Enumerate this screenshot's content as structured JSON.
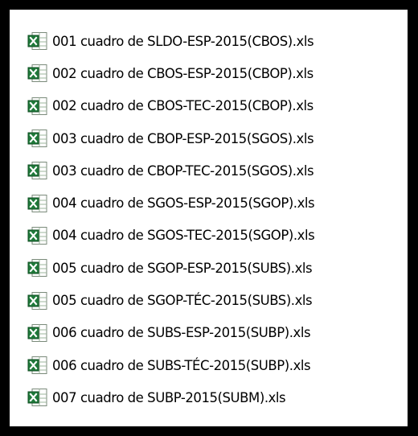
{
  "files": [
    {
      "name": "001 cuadro de SLDO-ESP-2015(CBOS).xls",
      "icon": "excel-file-icon"
    },
    {
      "name": "002 cuadro de CBOS-ESP-2015(CBOP).xls",
      "icon": "excel-file-icon"
    },
    {
      "name": "002 cuadro de CBOS-TEC-2015(CBOP).xls",
      "icon": "excel-file-icon"
    },
    {
      "name": "003 cuadro de CBOP-ESP-2015(SGOS).xls",
      "icon": "excel-file-icon"
    },
    {
      "name": "003 cuadro de CBOP-TEC-2015(SGOS).xls",
      "icon": "excel-file-icon"
    },
    {
      "name": "004 cuadro de SGOS-ESP-2015(SGOP).xls",
      "icon": "excel-file-icon"
    },
    {
      "name": "004 cuadro de SGOS-TEC-2015(SGOP).xls",
      "icon": "excel-file-icon"
    },
    {
      "name": "005 cuadro de SGOP-ESP-2015(SUBS).xls",
      "icon": "excel-file-icon"
    },
    {
      "name": "005 cuadro de SGOP-TÉC-2015(SUBS).xls",
      "icon": "excel-file-icon"
    },
    {
      "name": "006 cuadro de SUBS-ESP-2015(SUBP).xls",
      "icon": "excel-file-icon"
    },
    {
      "name": "006 cuadro de SUBS-TÉC-2015(SUBP).xls",
      "icon": "excel-file-icon"
    },
    {
      "name": "007 cuadro de SUBP-2015(SUBM).xls",
      "icon": "excel-file-icon"
    }
  ],
  "colors": {
    "frame": "#000000",
    "background": "#ffffff",
    "excel_green": "#1f7a3a",
    "excel_green_light": "#3fa85a"
  }
}
